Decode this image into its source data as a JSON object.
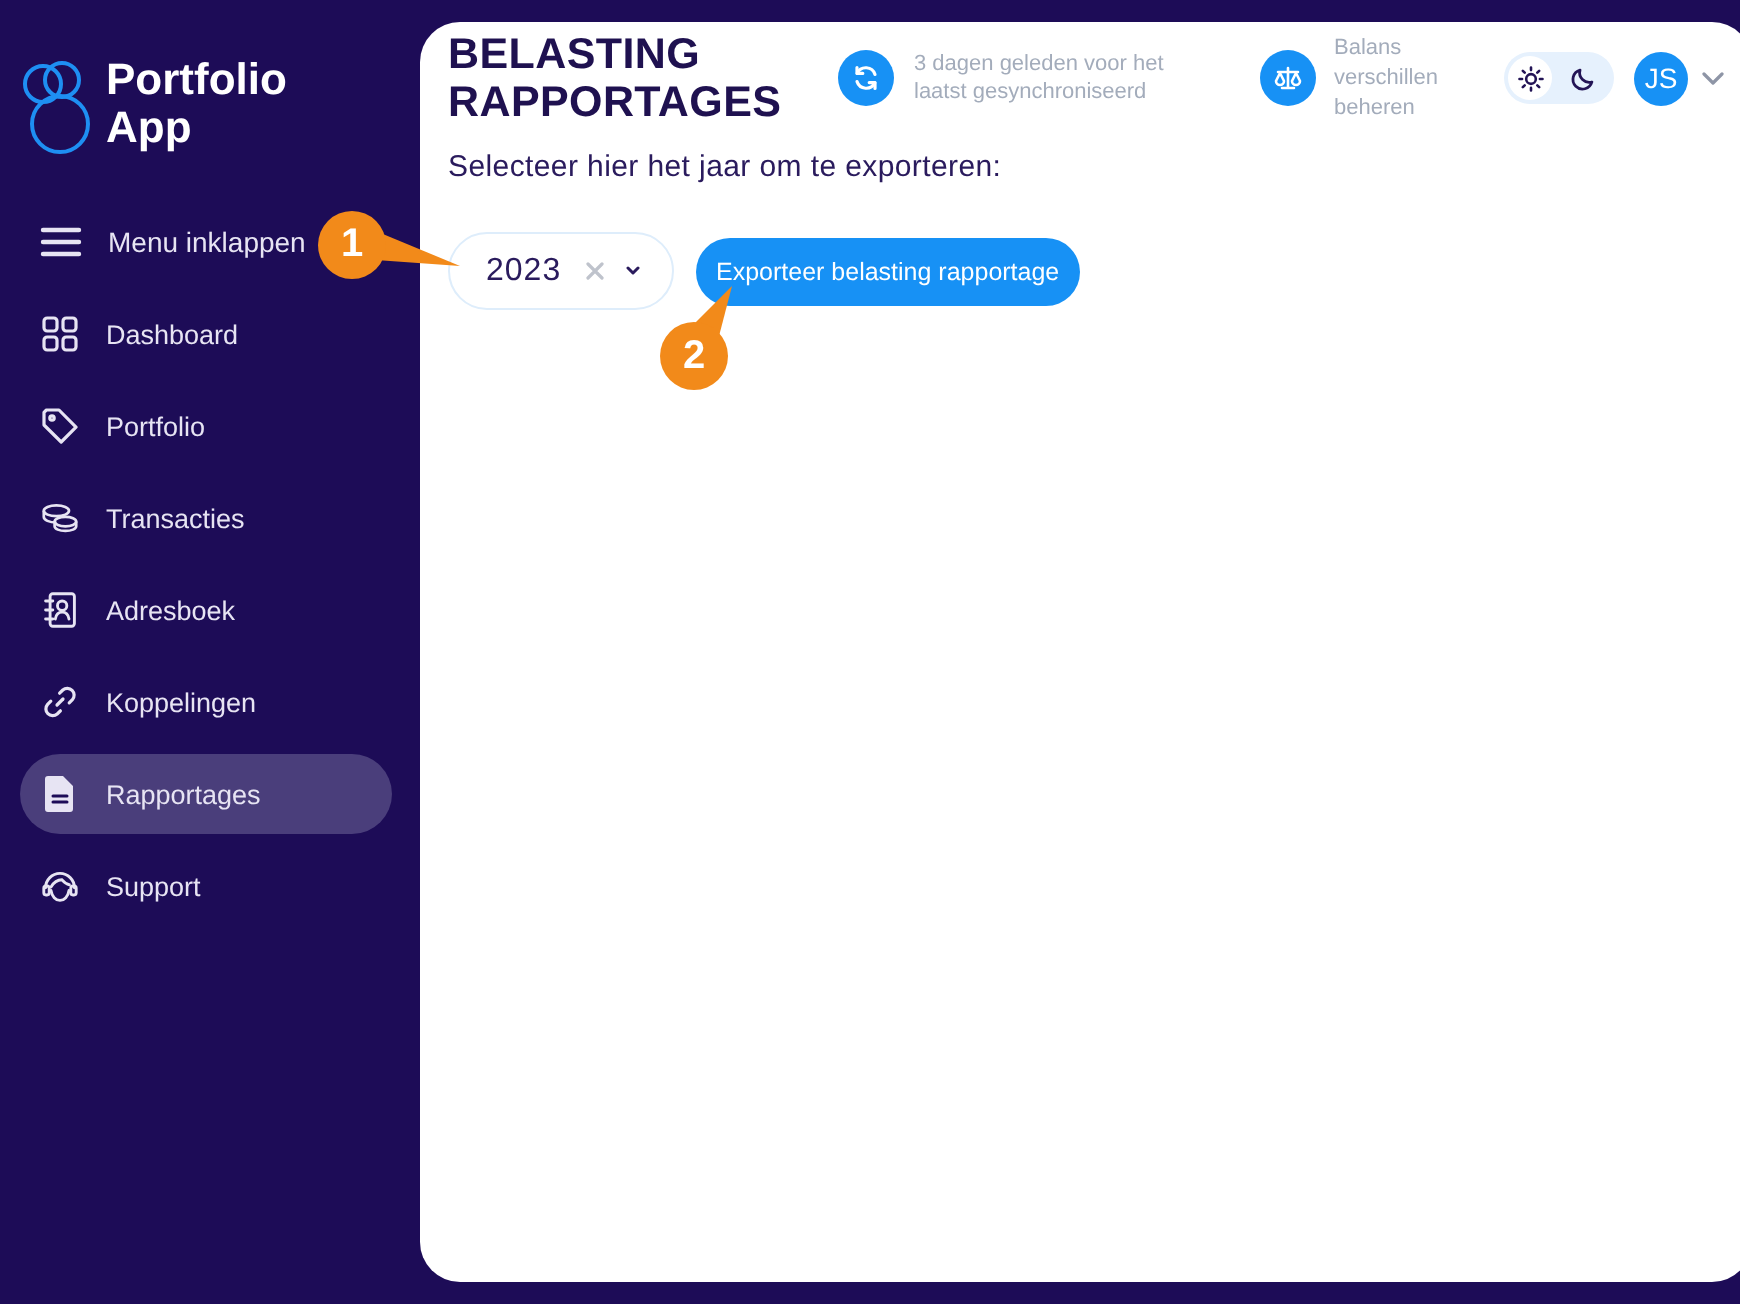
{
  "sidebar": {
    "logo": {
      "text": "Portfolio App"
    },
    "collapse": {
      "label": "Menu inklappen"
    },
    "items": [
      {
        "label": "Dashboard",
        "selected": false
      },
      {
        "label": "Portfolio",
        "selected": false
      },
      {
        "label": "Transacties",
        "selected": false
      },
      {
        "label": "Adresboek",
        "selected": false
      },
      {
        "label": "Koppelingen",
        "selected": false
      },
      {
        "label": "Rapportages",
        "selected": true
      },
      {
        "label": "Support",
        "selected": false
      }
    ]
  },
  "header": {
    "title": "BELASTING RAPPORTAGES",
    "sync": {
      "text": "3 dagen geleden voor het laatst gesynchroniseerd"
    },
    "balance": {
      "text": "Balans verschillen beheren"
    },
    "theme_toggle": [
      {
        "selected": true
      },
      {
        "selected": false
      }
    ],
    "user": {
      "initials": "JS"
    }
  },
  "content": {
    "prompt": "Selecteer hier het jaar om te exporteren:",
    "year_select": {
      "value": "2023"
    },
    "export_button": {
      "label": "Exporteer belasting rapportage"
    }
  },
  "annotations": [
    {
      "label": "1"
    },
    {
      "label": "2"
    }
  ]
}
